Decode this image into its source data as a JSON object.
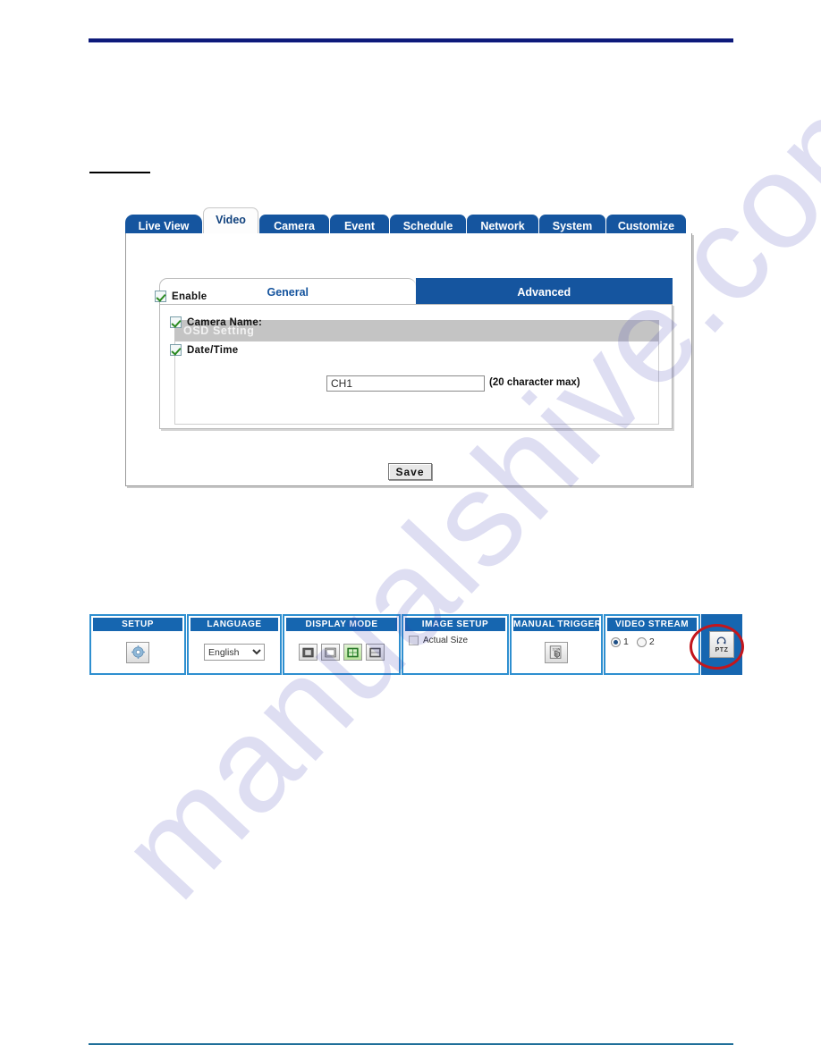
{
  "document": {
    "watermark": "manualshive.com"
  },
  "app": {
    "tabs": [
      {
        "label": "Live View",
        "active": false
      },
      {
        "label": "Video",
        "active": true
      },
      {
        "label": "Camera",
        "active": false
      },
      {
        "label": "Event",
        "active": false
      },
      {
        "label": "Schedule",
        "active": false
      },
      {
        "label": "Network",
        "active": false
      },
      {
        "label": "System",
        "active": false
      },
      {
        "label": "Customize",
        "active": false
      }
    ],
    "subtabs": [
      {
        "label": "General",
        "active": true
      },
      {
        "label": "Advanced",
        "active": false
      }
    ],
    "osd": {
      "title": "OSD Setting",
      "enable_label": "Enable",
      "enable_checked": true,
      "camera_name_label": "Camera Name:",
      "camera_name_checked": true,
      "camera_name_value": "CH1",
      "camera_name_hint": "(20 character max)",
      "date_time_label": "Date/Time",
      "date_time_checked": true
    },
    "save_label": "Save"
  },
  "toolbar": {
    "setup": {
      "title": "SETUP",
      "icon": "gear-icon"
    },
    "language": {
      "title": "LANGUAGE",
      "selected": "English",
      "options": [
        "English"
      ]
    },
    "display_mode": {
      "title": "DISPLAY MODE",
      "buttons": [
        {
          "icon": "single-view-icon",
          "selected": false
        },
        {
          "icon": "full-screen-icon",
          "selected": false
        },
        {
          "icon": "quad-view-icon",
          "selected": true
        },
        {
          "icon": "split-view-icon",
          "selected": false
        }
      ]
    },
    "image_setup": {
      "title": "IMAGE SETUP",
      "actual_size_label": "Actual Size",
      "actual_size_checked": false
    },
    "manual_trigger": {
      "title": "MANUAL TRIGGER",
      "icon": "hand-trigger-icon"
    },
    "video_stream": {
      "title": "VIDEO STREAM",
      "options": [
        {
          "label": "1",
          "selected": true
        },
        {
          "label": "2",
          "selected": false
        }
      ]
    },
    "ptz": {
      "label": "PTZ",
      "icon": "ptz-rotate-icon",
      "highlight_color": "#c3161c"
    }
  }
}
